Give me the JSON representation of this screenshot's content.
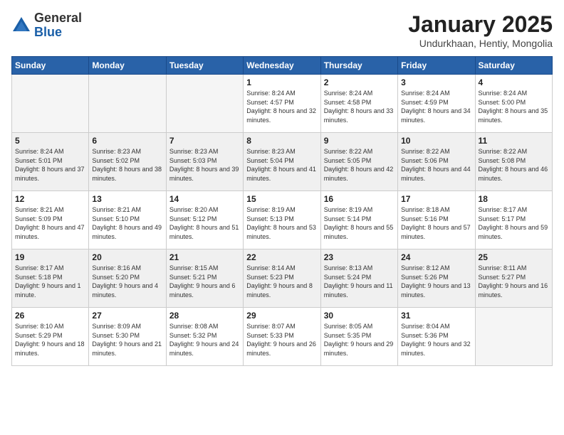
{
  "logo": {
    "general": "General",
    "blue": "Blue"
  },
  "header": {
    "month": "January 2025",
    "location": "Undurkhaan, Hentiy, Mongolia"
  },
  "weekdays": [
    "Sunday",
    "Monday",
    "Tuesday",
    "Wednesday",
    "Thursday",
    "Friday",
    "Saturday"
  ],
  "weeks": [
    [
      {
        "day": "",
        "info": ""
      },
      {
        "day": "",
        "info": ""
      },
      {
        "day": "",
        "info": ""
      },
      {
        "day": "1",
        "info": "Sunrise: 8:24 AM\nSunset: 4:57 PM\nDaylight: 8 hours\nand 32 minutes."
      },
      {
        "day": "2",
        "info": "Sunrise: 8:24 AM\nSunset: 4:58 PM\nDaylight: 8 hours\nand 33 minutes."
      },
      {
        "day": "3",
        "info": "Sunrise: 8:24 AM\nSunset: 4:59 PM\nDaylight: 8 hours\nand 34 minutes."
      },
      {
        "day": "4",
        "info": "Sunrise: 8:24 AM\nSunset: 5:00 PM\nDaylight: 8 hours\nand 35 minutes."
      }
    ],
    [
      {
        "day": "5",
        "info": "Sunrise: 8:24 AM\nSunset: 5:01 PM\nDaylight: 8 hours\nand 37 minutes."
      },
      {
        "day": "6",
        "info": "Sunrise: 8:23 AM\nSunset: 5:02 PM\nDaylight: 8 hours\nand 38 minutes."
      },
      {
        "day": "7",
        "info": "Sunrise: 8:23 AM\nSunset: 5:03 PM\nDaylight: 8 hours\nand 39 minutes."
      },
      {
        "day": "8",
        "info": "Sunrise: 8:23 AM\nSunset: 5:04 PM\nDaylight: 8 hours\nand 41 minutes."
      },
      {
        "day": "9",
        "info": "Sunrise: 8:22 AM\nSunset: 5:05 PM\nDaylight: 8 hours\nand 42 minutes."
      },
      {
        "day": "10",
        "info": "Sunrise: 8:22 AM\nSunset: 5:06 PM\nDaylight: 8 hours\nand 44 minutes."
      },
      {
        "day": "11",
        "info": "Sunrise: 8:22 AM\nSunset: 5:08 PM\nDaylight: 8 hours\nand 46 minutes."
      }
    ],
    [
      {
        "day": "12",
        "info": "Sunrise: 8:21 AM\nSunset: 5:09 PM\nDaylight: 8 hours\nand 47 minutes."
      },
      {
        "day": "13",
        "info": "Sunrise: 8:21 AM\nSunset: 5:10 PM\nDaylight: 8 hours\nand 49 minutes."
      },
      {
        "day": "14",
        "info": "Sunrise: 8:20 AM\nSunset: 5:12 PM\nDaylight: 8 hours\nand 51 minutes."
      },
      {
        "day": "15",
        "info": "Sunrise: 8:19 AM\nSunset: 5:13 PM\nDaylight: 8 hours\nand 53 minutes."
      },
      {
        "day": "16",
        "info": "Sunrise: 8:19 AM\nSunset: 5:14 PM\nDaylight: 8 hours\nand 55 minutes."
      },
      {
        "day": "17",
        "info": "Sunrise: 8:18 AM\nSunset: 5:16 PM\nDaylight: 8 hours\nand 57 minutes."
      },
      {
        "day": "18",
        "info": "Sunrise: 8:17 AM\nSunset: 5:17 PM\nDaylight: 8 hours\nand 59 minutes."
      }
    ],
    [
      {
        "day": "19",
        "info": "Sunrise: 8:17 AM\nSunset: 5:18 PM\nDaylight: 9 hours\nand 1 minute."
      },
      {
        "day": "20",
        "info": "Sunrise: 8:16 AM\nSunset: 5:20 PM\nDaylight: 9 hours\nand 4 minutes."
      },
      {
        "day": "21",
        "info": "Sunrise: 8:15 AM\nSunset: 5:21 PM\nDaylight: 9 hours\nand 6 minutes."
      },
      {
        "day": "22",
        "info": "Sunrise: 8:14 AM\nSunset: 5:23 PM\nDaylight: 9 hours\nand 8 minutes."
      },
      {
        "day": "23",
        "info": "Sunrise: 8:13 AM\nSunset: 5:24 PM\nDaylight: 9 hours\nand 11 minutes."
      },
      {
        "day": "24",
        "info": "Sunrise: 8:12 AM\nSunset: 5:26 PM\nDaylight: 9 hours\nand 13 minutes."
      },
      {
        "day": "25",
        "info": "Sunrise: 8:11 AM\nSunset: 5:27 PM\nDaylight: 9 hours\nand 16 minutes."
      }
    ],
    [
      {
        "day": "26",
        "info": "Sunrise: 8:10 AM\nSunset: 5:29 PM\nDaylight: 9 hours\nand 18 minutes."
      },
      {
        "day": "27",
        "info": "Sunrise: 8:09 AM\nSunset: 5:30 PM\nDaylight: 9 hours\nand 21 minutes."
      },
      {
        "day": "28",
        "info": "Sunrise: 8:08 AM\nSunset: 5:32 PM\nDaylight: 9 hours\nand 24 minutes."
      },
      {
        "day": "29",
        "info": "Sunrise: 8:07 AM\nSunset: 5:33 PM\nDaylight: 9 hours\nand 26 minutes."
      },
      {
        "day": "30",
        "info": "Sunrise: 8:05 AM\nSunset: 5:35 PM\nDaylight: 9 hours\nand 29 minutes."
      },
      {
        "day": "31",
        "info": "Sunrise: 8:04 AM\nSunset: 5:36 PM\nDaylight: 9 hours\nand 32 minutes."
      },
      {
        "day": "",
        "info": ""
      }
    ]
  ]
}
